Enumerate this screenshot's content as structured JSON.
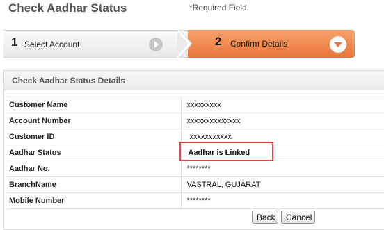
{
  "header": {
    "title": "Check Aadhar Status",
    "required_note": "*Required Field."
  },
  "wizard": {
    "steps": [
      {
        "number": "1",
        "label": "Select Account",
        "state": "completed"
      },
      {
        "number": "2",
        "label": "Confirm Details",
        "state": "active"
      }
    ],
    "active_color": "#ee7d44"
  },
  "details": {
    "title": "Check Aadhar Status Details",
    "rows": [
      {
        "label": "Customer Name",
        "value": "xxxxxxxxx"
      },
      {
        "label": "Account Number",
        "value": "xxxxxxxxxxxxxx"
      },
      {
        "label": "Customer ID",
        "value": "xxxxxxxxxxx"
      },
      {
        "label": "Aadhar Status",
        "value": "Aadhar is Linked"
      },
      {
        "label": "Aadhar No.",
        "value": "********"
      },
      {
        "label": "BranchName",
        "value": "VASTRAL, GUJARAT"
      },
      {
        "label": "Mobile Number",
        "value": "********"
      }
    ],
    "highlight_color": "#e04848"
  },
  "actions": {
    "back_label": "Back",
    "cancel_label": "Cancel"
  }
}
